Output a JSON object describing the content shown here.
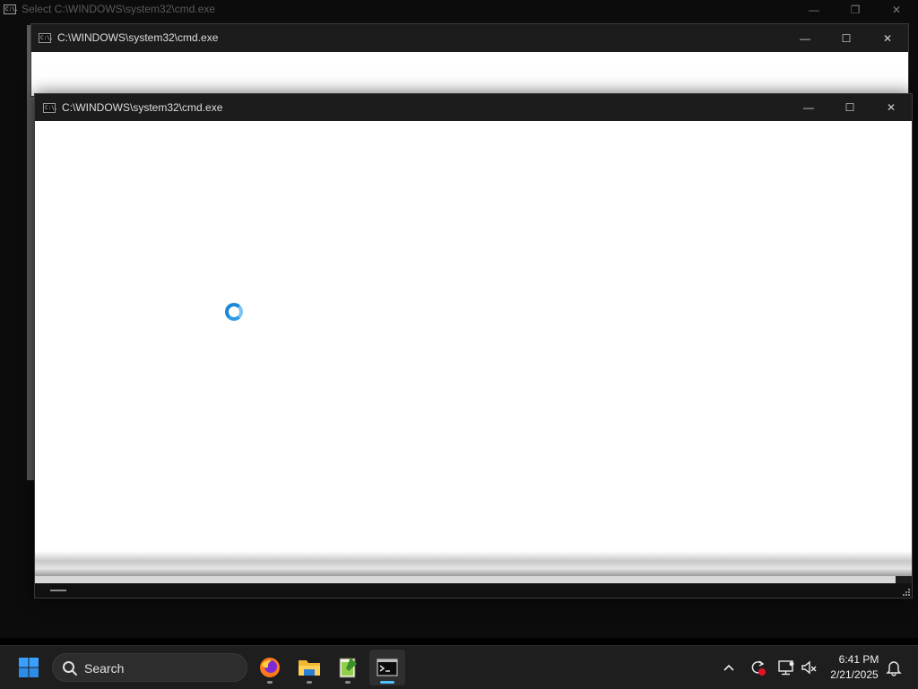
{
  "back_window": {
    "title": "Select C:\\WINDOWS\\system32\\cmd.exe",
    "icon": "cmd-icon"
  },
  "middle_window": {
    "title": "C:\\WINDOWS\\system32\\cmd.exe",
    "icon": "cmd-icon"
  },
  "front_window": {
    "title": "C:\\WINDOWS\\system32\\cmd.exe",
    "icon": "cmd-icon",
    "loading": true
  },
  "cmd_icon_text": "C:\\.",
  "caption_buttons": {
    "minimize": "—",
    "maximize": "☐",
    "restore": "❐",
    "close": "✕"
  },
  "taskbar": {
    "start_icon": "windows-start-icon",
    "search_placeholder": "Search",
    "pinned": [
      {
        "name": "firefox",
        "icon": "firefox-icon",
        "active": false
      },
      {
        "name": "file-explorer",
        "icon": "folder-icon",
        "active": false
      },
      {
        "name": "notepad-plus-plus",
        "icon": "notepad-plus-plus-icon",
        "active": false
      },
      {
        "name": "command-prompt",
        "icon": "terminal-icon",
        "active": true
      }
    ],
    "tray": [
      {
        "name": "show-hidden-icons",
        "icon": "chevron-up-icon"
      },
      {
        "name": "update",
        "icon": "sync-alert-icon"
      },
      {
        "name": "network",
        "icon": "network-icon"
      },
      {
        "name": "volume",
        "icon": "volume-muted-icon"
      }
    ],
    "time": "6:41 PM",
    "date": "2/21/2025",
    "notification_icon": "bell-icon"
  },
  "colors": {
    "taskbar": "#1e1e1e",
    "accent": "#4cc2ff",
    "spinner": "#1a86d8"
  }
}
